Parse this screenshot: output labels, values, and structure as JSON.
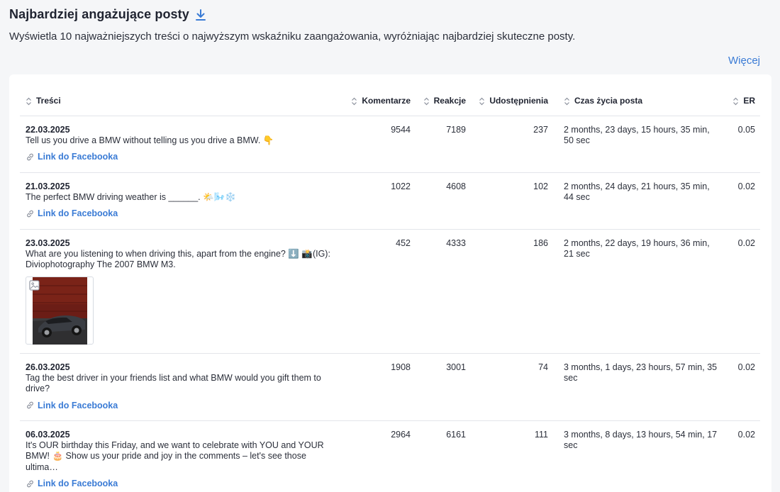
{
  "header": {
    "title": "Najbardziej angażujące posty",
    "subtitle": "Wyświetla 10 najważniejszych treści o najwyższym wskaźniku zaangażowania, wyróżniając najbardziej skuteczne posty.",
    "more_label": "Więcej"
  },
  "colors": {
    "accent": "#3a7bd5",
    "border": "#e3e5ea",
    "background": "#f5f6f8"
  },
  "table": {
    "columns": {
      "content": "Treści",
      "comments": "Komentarze",
      "reactions": "Reakcje",
      "shares": "Udostępnienia",
      "lifetime": "Czas życia posta",
      "er": "ER"
    },
    "rows": [
      {
        "date": "22.03.2025",
        "text": "Tell us you drive a BMW without telling us you drive a BMW. 👇",
        "link_label": "Link do Facebooka",
        "comments": "9544",
        "reactions": "7189",
        "shares": "237",
        "lifetime": "2 months, 23 days, 15 hours, 35 min, 50 sec",
        "er": "0.05"
      },
      {
        "date": "21.03.2025",
        "text": "The perfect BMW driving weather is ______. 🌤️🌬️❄️",
        "link_label": "Link do Facebooka",
        "comments": "1022",
        "reactions": "4608",
        "shares": "102",
        "lifetime": "2 months, 24 days, 21 hours, 35 min, 44 sec",
        "er": "0.02"
      },
      {
        "date": "23.03.2025",
        "text": "What are you listening to when driving this, apart from the engine? ⬇️ 📸(IG): Diviophotography The 2007 BMW M3.",
        "image_icon": "image-icon",
        "comments": "452",
        "reactions": "4333",
        "shares": "186",
        "lifetime": "2 months, 22 days, 19 hours, 36 min, 21 sec",
        "er": "0.02"
      },
      {
        "date": "26.03.2025",
        "text": "Tag the best driver in your friends list and what BMW would you gift them to drive?",
        "link_label": "Link do Facebooka",
        "comments": "1908",
        "reactions": "3001",
        "shares": "74",
        "lifetime": "3 months, 1 days, 23 hours, 57 min, 35 sec",
        "er": "0.02"
      },
      {
        "date": "06.03.2025",
        "text": "It's OUR birthday this Friday, and we want to celebrate with YOU and YOUR BMW! 🎂 Show us your pride and joy in the comments – let's see those ultima…",
        "link_label": "Link do Facebooka",
        "comments": "2964",
        "reactions": "6161",
        "shares": "111",
        "lifetime": "3 months, 8 days, 13 hours, 54 min, 17 sec",
        "er": "0.02"
      }
    ]
  }
}
